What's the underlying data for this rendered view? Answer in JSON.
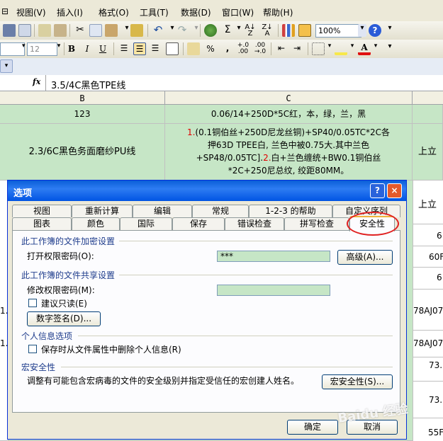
{
  "menu": [
    "视图(V)",
    "插入(I)",
    "格式(O)",
    "工具(T)",
    "数据(D)",
    "窗口(W)",
    "帮助(H)"
  ],
  "toolbar": {
    "zoom": "100%",
    "font_size": "12",
    "bold": "B",
    "italic": "I",
    "underline": "U",
    "percent": "%",
    "comma": ",",
    "sigma": "Σ"
  },
  "formula_bar": {
    "fx": "fx",
    "value": "3.5/4C黑色TPE线"
  },
  "columns": {
    "b": "B",
    "c": "C"
  },
  "cells": {
    "r1_b": "123",
    "r1_c": "0.06/14+250D*5C红，本，绿，兰，黑",
    "r2_b": "2.3/6C黑色务面磨纱PU线",
    "r2_c1_num": "1.",
    "r2_c1": "(0.1铜伯丝+250D尼龙丝铜)+SP40/0.05TC*2C各",
    "r2_c2": "押63D TPEE白, 兰色中被0.75大.其中兰色",
    "r2_c3_a": "+SP48/0.05TC].",
    "r2_c3_num": "2.",
    "r2_c3_b": "白+兰色缠统+BW0.1铜伯丝",
    "r2_c4": "*2C+250尼总纹, 绞距80MM。",
    "right1": "上立",
    "right2": "上立",
    "right3": "6",
    "right4": "60F",
    "right5": "6",
    "right6": "78AJ07",
    "right7": "78AJ07",
    "right8": "73.",
    "right9": "73.",
    "right10": "55F",
    "left1": "1.",
    "left2": "1."
  },
  "dialog": {
    "title": "选项",
    "help_btn": "?",
    "close_btn": "×",
    "tabs_row1": [
      "视图",
      "重新计算",
      "编辑",
      "常规",
      "1-2-3 的帮助",
      "自定义序列"
    ],
    "tabs_row2": [
      "图表",
      "颜色",
      "国际",
      "保存",
      "错误检查",
      "拼写检查",
      "安全性"
    ],
    "sec_encrypt": "此工作簿的文件加密设置",
    "open_pwd_label": "打开权限密码(O):",
    "open_pwd_value": "***",
    "advanced_btn": "高级(A)...",
    "sec_share": "此工作簿的文件共享设置",
    "modify_pwd_label": "修改权限密码(M):",
    "modify_pwd_value": "",
    "readonly_label": "建议只读(E)",
    "signature_btn": "数字签名(D)...",
    "sec_privacy": "个人信息选项",
    "remove_info_label": "保存时从文件属性中删除个人信息(R)",
    "sec_macro": "宏安全性",
    "macro_desc": "调整有可能包含宏病毒的文件的安全级别并指定受信任的宏创建人姓名。",
    "macro_btn": "宏安全性(S)...",
    "ok_btn": "确定",
    "cancel_btn": "取消"
  },
  "watermark": "Baidu 经验",
  "colors": {
    "title_bar": "#0054e3",
    "cell_green": "#c6e6c6",
    "highlight_circle": "#e02020"
  }
}
